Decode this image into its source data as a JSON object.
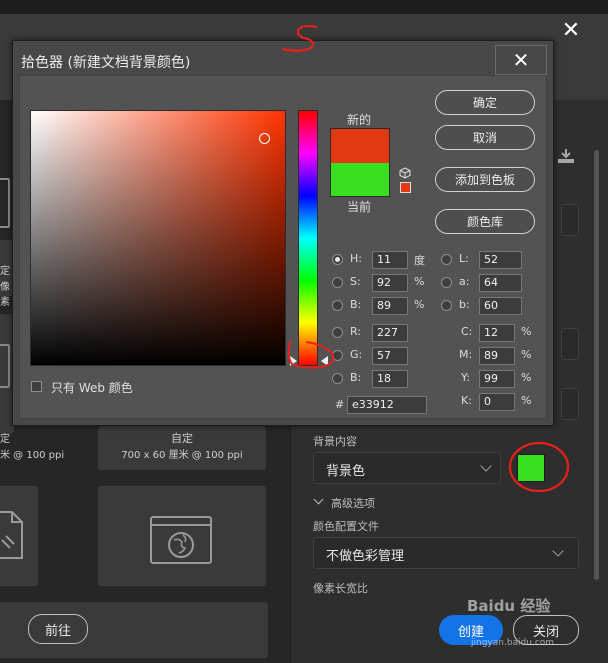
{
  "background_dialog": {
    "close_glyph": "✕",
    "tiles": [
      {
        "name": "",
        "size": ""
      },
      {
        "name": "自定",
        "size": "700 x 60 厘米 @ 100 ppi"
      }
    ],
    "left_fragments": {
      "row1_a": "定",
      "row1_b": "像素",
      "row2_a": "定",
      "row2_b": "米 @ 100 ppi"
    },
    "background_content_label": "背景内容",
    "background_content_value": "背景色",
    "background_color": "#39e01f",
    "advanced_label": "高级选项",
    "color_profile_label": "颜色配置文件",
    "color_profile_value": "不做色彩管理",
    "pixel_aspect_label": "像素长宽比",
    "prev_button": "前往",
    "create_button": "创建",
    "close_button": "关闭",
    "watermark": "Baidu 经验",
    "watermark_url": "jingyan.baidu.com"
  },
  "picker": {
    "title": "拾色器 (新建文档背景颜色)",
    "close_glyph": "✕",
    "new_label": "新的",
    "current_label": "当前",
    "new_color": "#e33912",
    "current_color": "#39e01f",
    "buttons": {
      "ok": "确定",
      "cancel": "取消",
      "add_swatch": "添加到色板",
      "color_library": "颜色库"
    },
    "hsb": {
      "h_label": "H:",
      "h_value": "11",
      "h_unit": "度",
      "s_label": "S:",
      "s_value": "92",
      "s_unit": "%",
      "b_label": "B:",
      "b_value": "89",
      "b_unit": "%"
    },
    "lab": {
      "l_label": "L:",
      "l_value": "52",
      "a_label": "a:",
      "a_value": "64",
      "b_label": "b:",
      "b_value": "60"
    },
    "rgb": {
      "r_label": "R:",
      "r_value": "227",
      "g_label": "G:",
      "g_value": "57",
      "b_label": "B:",
      "b_value": "18"
    },
    "cmyk": {
      "c_label": "C:",
      "c_value": "12",
      "m_label": "M:",
      "m_value": "89",
      "y_label": "Y:",
      "y_value": "99",
      "k_label": "K:",
      "k_value": "0",
      "unit": "%"
    },
    "hex_label": "#",
    "hex_value": "e33912",
    "web_only_label": "只有 Web 颜色",
    "hue_color": "#ff3300"
  }
}
